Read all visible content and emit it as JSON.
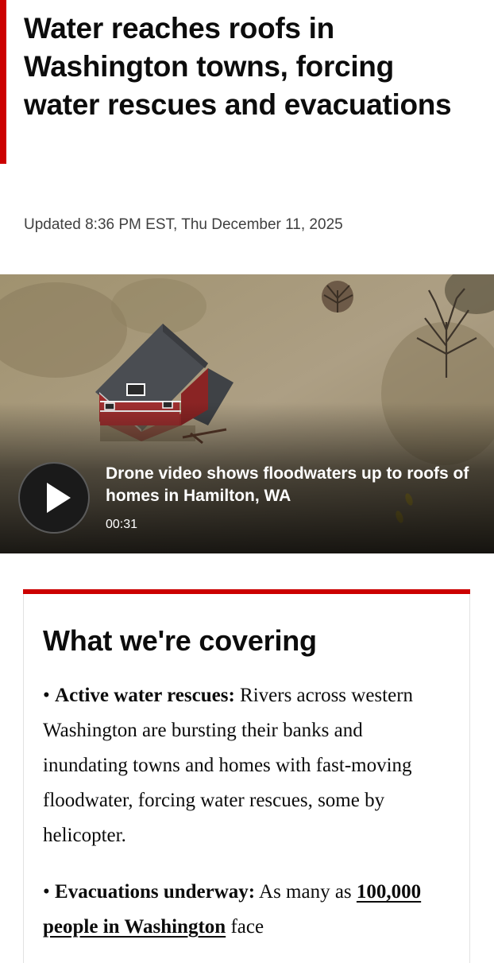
{
  "article": {
    "headline": "Water reaches roofs in Washington towns, forcing water rescues and evacuations",
    "timestamp": "Updated 8:36 PM EST, Thu December 11, 2025"
  },
  "video": {
    "title": "Drone video shows floodwaters up to roofs of homes in Hamilton, WA",
    "duration": "00:31",
    "play_icon": "play-icon"
  },
  "covering": {
    "title": "What we're covering",
    "bullets": [
      {
        "marker": "•",
        "heading": "Active water rescues:",
        "text": " Rivers across western Washington are bursting their banks and inundating towns and homes with fast-moving floodwater, forcing water rescues, some by helicopter."
      },
      {
        "marker": "•",
        "heading": "Evacuations underway:",
        "text": " As many as ",
        "link": "100,000 people in Washington",
        "text_after": " face"
      }
    ]
  },
  "colors": {
    "accent": "#cc0000",
    "text": "#0c0c0c",
    "muted": "#404040"
  }
}
